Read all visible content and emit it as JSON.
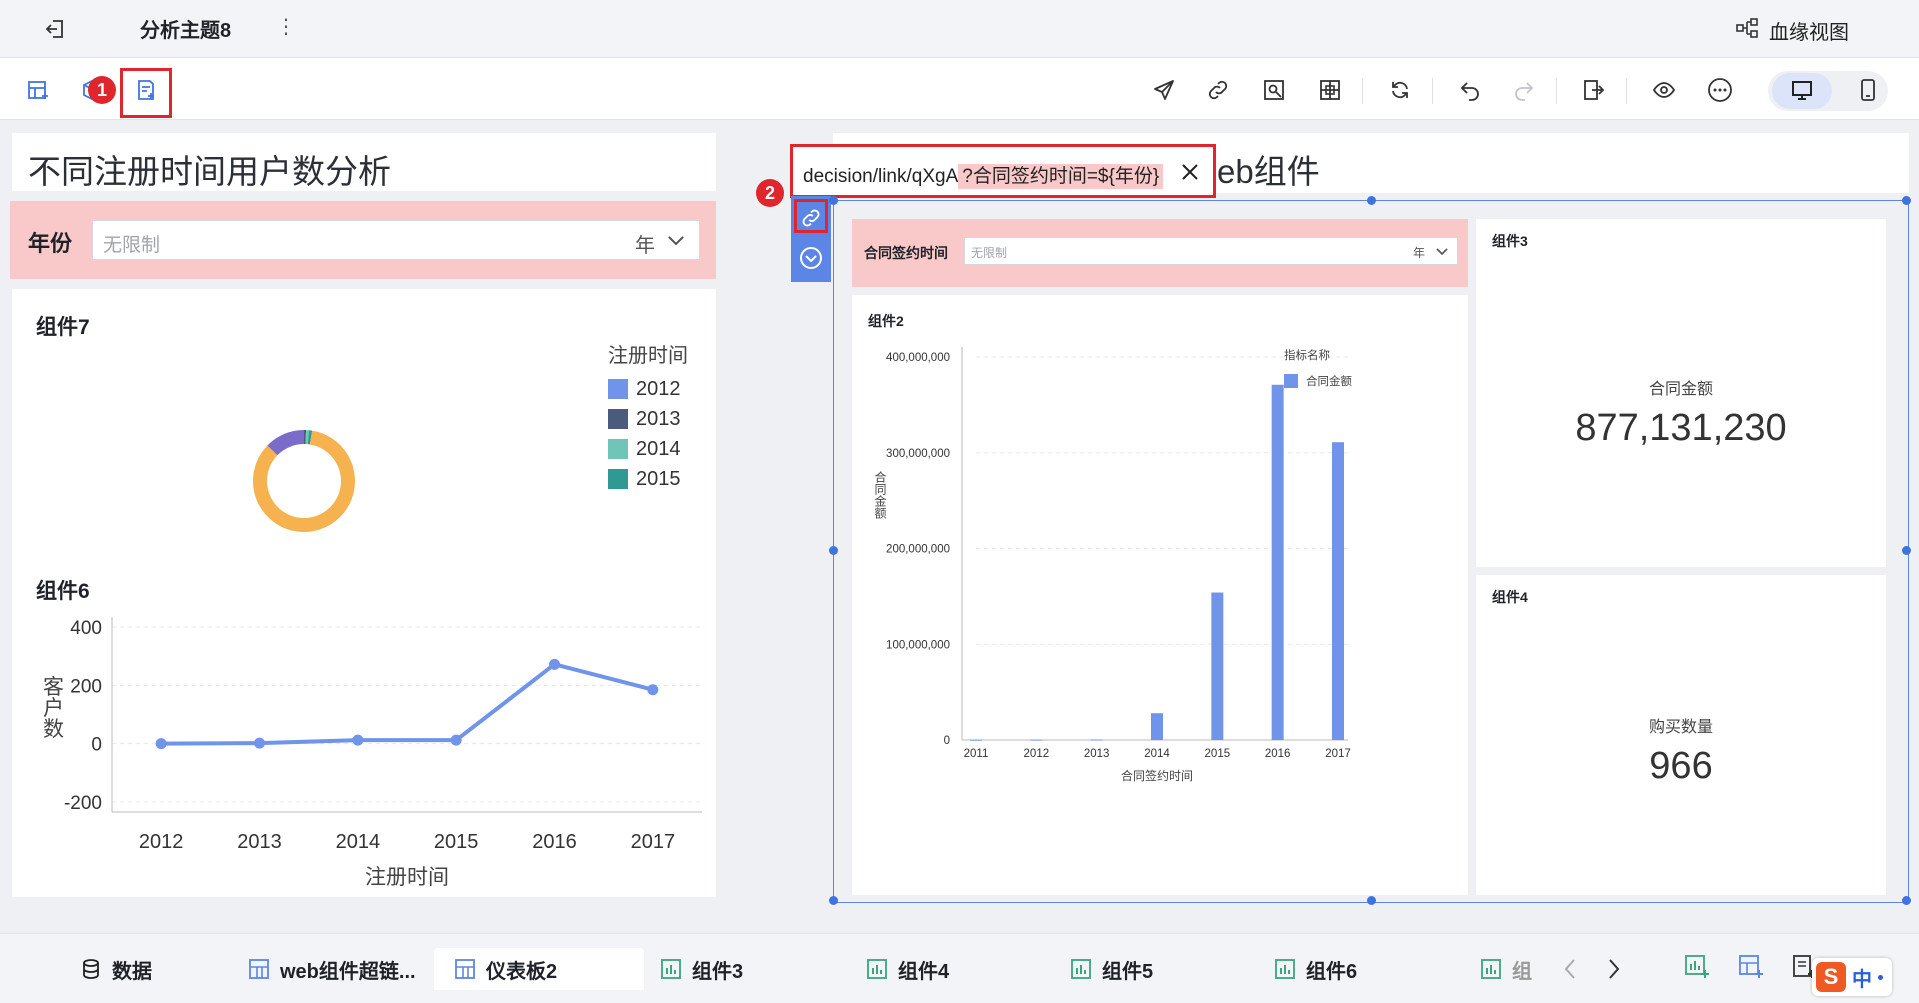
{
  "app": {
    "title": "分析主题8",
    "lineage_label": "血缘视图"
  },
  "toolbar": {
    "badge1": "1",
    "badge2": "2"
  },
  "left": {
    "header_title": "不同注册时间用户数分析",
    "filter": {
      "label": "年份",
      "placeholder": "无限制",
      "unit": "年"
    },
    "component7": {
      "title": "组件7",
      "legend_title": "注册时间",
      "legend": [
        {
          "label": "2012",
          "color": "#6f94ea"
        },
        {
          "label": "2013",
          "color": "#4a5b7e"
        },
        {
          "label": "2014",
          "color": "#6fc6b8"
        },
        {
          "label": "2015",
          "color": "#2f9a93"
        }
      ]
    },
    "component6": {
      "title": "组件6"
    }
  },
  "right": {
    "header_title_visible": "eb组件",
    "url_popup": {
      "prefix": "decision/link/qXgA",
      "param": "?合同签约时间=${年份}"
    },
    "filter": {
      "label": "合同签约时间",
      "placeholder": "无限制",
      "unit": "年"
    },
    "component2": {
      "title": "组件2"
    },
    "component3": {
      "title": "组件3",
      "metric_label": "合同金额",
      "metric_value": "877,131,230"
    },
    "component4": {
      "title": "组件4",
      "metric_label": "购买数量",
      "metric_value": "966"
    }
  },
  "chart_data": [
    {
      "type": "pie",
      "title": "组件7",
      "legend_title": "注册时间",
      "categories": [
        "2012",
        "2013",
        "2014",
        "2015",
        "2016"
      ],
      "colors": [
        "#7b6cc9",
        "#4a5b7e",
        "#6fc6b8",
        "#2f9a93",
        "#f5b24e"
      ],
      "values": [
        40,
        2,
        3,
        3,
        265
      ]
    },
    {
      "type": "line",
      "title": "组件6",
      "xlabel": "注册时间",
      "ylabel": "客户数",
      "x": [
        "2012",
        "2013",
        "2014",
        "2015",
        "2016",
        "2017"
      ],
      "values": [
        0,
        2,
        12,
        12,
        272,
        185
      ],
      "yticks": [
        "400",
        "200",
        "0",
        "-200"
      ],
      "ylim": [
        -200,
        400
      ],
      "color": "#6f94ea"
    },
    {
      "type": "bar",
      "title": "组件2",
      "xlabel": "合同签约时间",
      "ylabel": "合同金额",
      "legend_title": "指标名称",
      "series": [
        {
          "name": "合同金额",
          "color": "#6f94ea"
        }
      ],
      "categories": [
        "2011",
        "2012",
        "2013",
        "2014",
        "2015",
        "2016",
        "2017"
      ],
      "values": [
        300000,
        400000,
        500000,
        28000000,
        154000000,
        371000000,
        311000000
      ],
      "yticks": [
        "400,000,000",
        "300,000,000",
        "200,000,000",
        "100,000,000",
        "0"
      ],
      "ylim": [
        0,
        400000000
      ]
    }
  ],
  "tabs": [
    {
      "label": "数据"
    },
    {
      "label": "web组件超链..."
    },
    {
      "label": "仪表板2"
    },
    {
      "label": "组件3"
    },
    {
      "label": "组件4"
    },
    {
      "label": "组件5"
    },
    {
      "label": "组件6"
    },
    {
      "label": "组"
    }
  ],
  "ime": {
    "label": "中"
  }
}
